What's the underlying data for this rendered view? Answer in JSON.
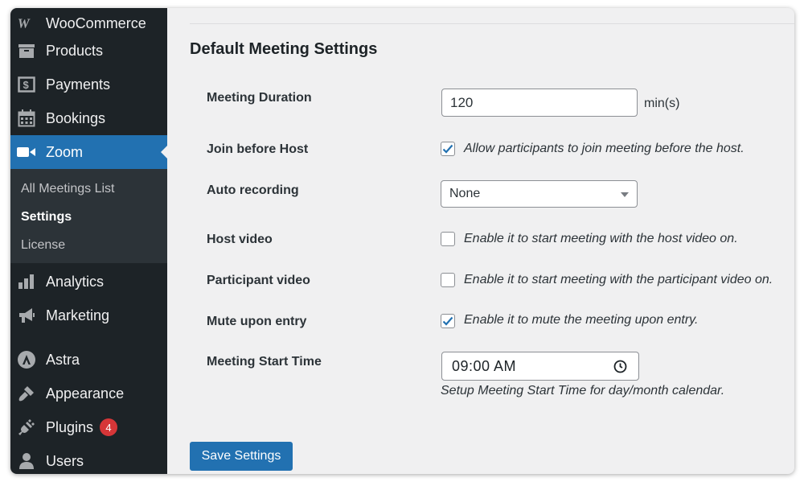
{
  "sidebar": {
    "items": [
      {
        "label": "WooCommerce",
        "icon": "woocommerce-icon"
      },
      {
        "label": "Products",
        "icon": "archive-icon"
      },
      {
        "label": "Payments",
        "icon": "payments-icon"
      },
      {
        "label": "Bookings",
        "icon": "calendar-icon"
      },
      {
        "label": "Zoom",
        "icon": "video-camera-icon"
      },
      {
        "label": "Analytics",
        "icon": "bar-chart-icon"
      },
      {
        "label": "Marketing",
        "icon": "megaphone-icon"
      },
      {
        "label": "Astra",
        "icon": "astra-icon"
      },
      {
        "label": "Appearance",
        "icon": "paintbrush-icon"
      },
      {
        "label": "Plugins",
        "icon": "plug-icon",
        "badge": "4"
      },
      {
        "label": "Users",
        "icon": "user-icon"
      }
    ],
    "submenu": [
      {
        "label": "All Meetings List"
      },
      {
        "label": "Settings"
      },
      {
        "label": "License"
      }
    ],
    "accent_color": "#2271b1"
  },
  "main": {
    "title": "Default Meeting Settings",
    "meeting_duration": {
      "label": "Meeting Duration",
      "value": "120",
      "unit": "min(s)"
    },
    "join_before_host": {
      "label": "Join before Host",
      "checked": true,
      "text": "Allow participants to join meeting before the host."
    },
    "auto_recording": {
      "label": "Auto recording",
      "selected": "None"
    },
    "host_video": {
      "label": "Host video",
      "checked": false,
      "text": "Enable it to start meeting with the host video on."
    },
    "participant_video": {
      "label": "Participant video",
      "checked": false,
      "text": "Enable it to start meeting with the participant video on."
    },
    "mute_upon_entry": {
      "label": "Mute upon entry",
      "checked": true,
      "text": "Enable it to mute the meeting upon entry."
    },
    "meeting_start_time": {
      "label": "Meeting Start Time",
      "value": "09:00 AM",
      "helper": "Setup Meeting Start Time for day/month calendar."
    },
    "save_label": "Save Settings"
  }
}
